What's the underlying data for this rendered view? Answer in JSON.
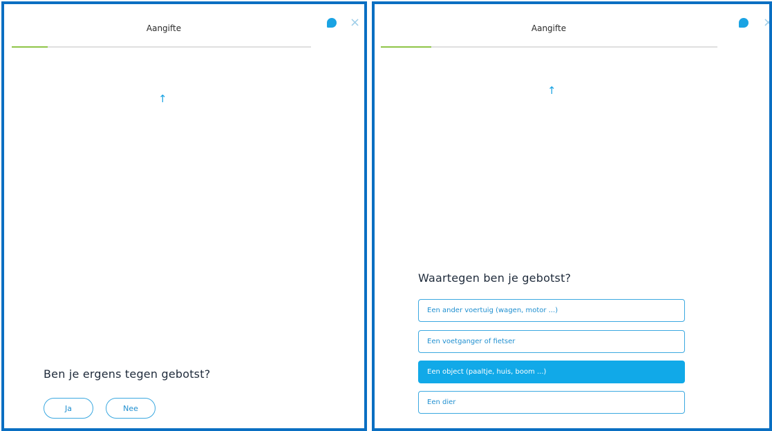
{
  "left_panel": {
    "title": "Aangifte",
    "progress_fraction": 0.12,
    "arrow": "↑",
    "question": "Ben je ergens tegen gebotst?",
    "answers": [
      "Ja",
      "Nee"
    ]
  },
  "right_panel": {
    "title": "Aangifte",
    "progress_fraction": 0.15,
    "arrow": "↑",
    "question": "Waartegen ben je gebotst?",
    "options": [
      {
        "label": "Een ander voertuig (wagen, motor ...)",
        "selected": false
      },
      {
        "label": "Een voetganger of fietser",
        "selected": false
      },
      {
        "label": "Een object (paaltje, huis, boom ...)",
        "selected": true
      },
      {
        "label": "Een dier",
        "selected": false
      }
    ]
  },
  "icons": {
    "chat": "chat-bubble-icon",
    "close": "close-icon",
    "close_glyph": "×",
    "arrow": "arrow-up-icon"
  },
  "colors": {
    "frame": "#0a6fc2",
    "accent": "#1aa3e3",
    "progress": "#8ec446",
    "selected_option": "#11a9e8"
  }
}
